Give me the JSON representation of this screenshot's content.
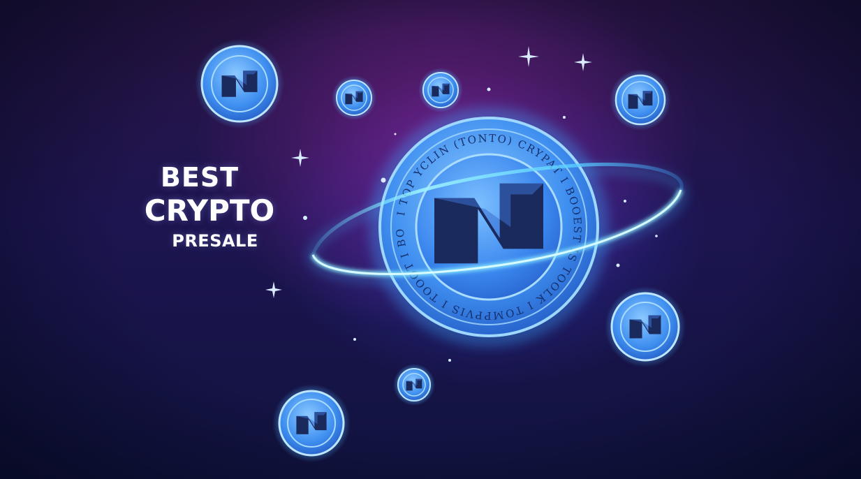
{
  "headline": {
    "line1": "BEST",
    "line2": "CRYPTO",
    "line3": "PRESALE"
  },
  "main_coin": {
    "ring_text": "I TOP YCLIN (TONTO) CRYPAT I BOOEST IS TOOLK I TOMPPVIS I TOOOT I BOO"
  },
  "colors": {
    "coin_light": "#6fb8ff",
    "coin_mid": "#3a8bf0",
    "coin_dark": "#1a3fa8",
    "glow": "#39a6ff",
    "logo_dark": "#1b2a5c"
  },
  "icons": {
    "coin_logo": "stylized-N-logo-icon",
    "sparkle": "sparkle-star-icon"
  }
}
